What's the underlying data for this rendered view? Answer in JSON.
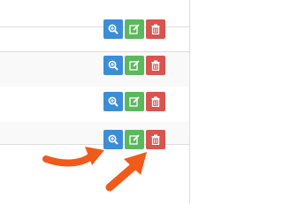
{
  "rows": [
    {
      "actions": [
        "view",
        "edit",
        "delete"
      ]
    },
    {
      "actions": [
        "view",
        "edit",
        "delete"
      ]
    },
    {
      "actions": [
        "view",
        "edit",
        "delete"
      ]
    },
    {
      "actions": [
        "view",
        "edit",
        "delete"
      ]
    }
  ],
  "icons": {
    "view": "zoom-in-icon",
    "edit": "edit-icon",
    "delete": "trash-icon",
    "annotation": "arrow-annotation"
  },
  "colors": {
    "view_button": "#3c8dd6",
    "edit_button": "#5cb85c",
    "delete_button": "#d9534f",
    "annotation_arrow": "#f05a1a",
    "row_stripe": "#f9f9f9",
    "border": "#dddddd"
  }
}
